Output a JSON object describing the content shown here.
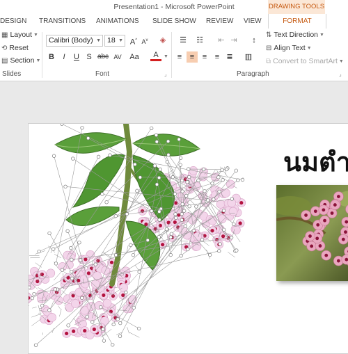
{
  "window": {
    "title": "Presentation1 - Microsoft PowerPoint",
    "contextual_tab_group": "DRAWING TOOLS"
  },
  "tabs": [
    {
      "label": "DESIGN"
    },
    {
      "label": "TRANSITIONS"
    },
    {
      "label": "ANIMATIONS"
    },
    {
      "label": "SLIDE SHOW"
    },
    {
      "label": "REVIEW"
    },
    {
      "label": "VIEW"
    },
    {
      "label": "FORMAT",
      "active": true
    }
  ],
  "ribbon": {
    "slides": {
      "label": "Slides",
      "layout": "Layout",
      "reset": "Reset",
      "section": "Section"
    },
    "font": {
      "label": "Font",
      "font_name": "Calibri (Body)",
      "font_size": "18",
      "bold": "B",
      "italic": "I",
      "underline": "U",
      "shadow": "S",
      "strikethrough": "abc",
      "spacing": "AV",
      "change_case": "Aa",
      "font_color": "A",
      "grow": "A",
      "shrink": "A"
    },
    "paragraph": {
      "label": "Paragraph",
      "text_direction": "Text Direction",
      "align_text": "Align Text",
      "convert_smartart": "Convert to SmartArt"
    }
  },
  "slide": {
    "title": "นมตำ"
  },
  "colors": {
    "accent": "#c65a11",
    "contextual_tab_bg": "#fbe7d6",
    "active_button_bg": "#f7cdb0",
    "leaf": "#5a9f3a",
    "flower": "#f3d5ea",
    "flower_center": "#b3123f"
  },
  "icons": {
    "layout": "layout-icon",
    "reset": "reset-icon",
    "section": "section-icon",
    "bullets": "bullets-icon",
    "numbering": "numbering-icon",
    "text_direction": "text-direction-icon",
    "align_text": "align-text-icon",
    "smartart": "smartart-icon"
  }
}
